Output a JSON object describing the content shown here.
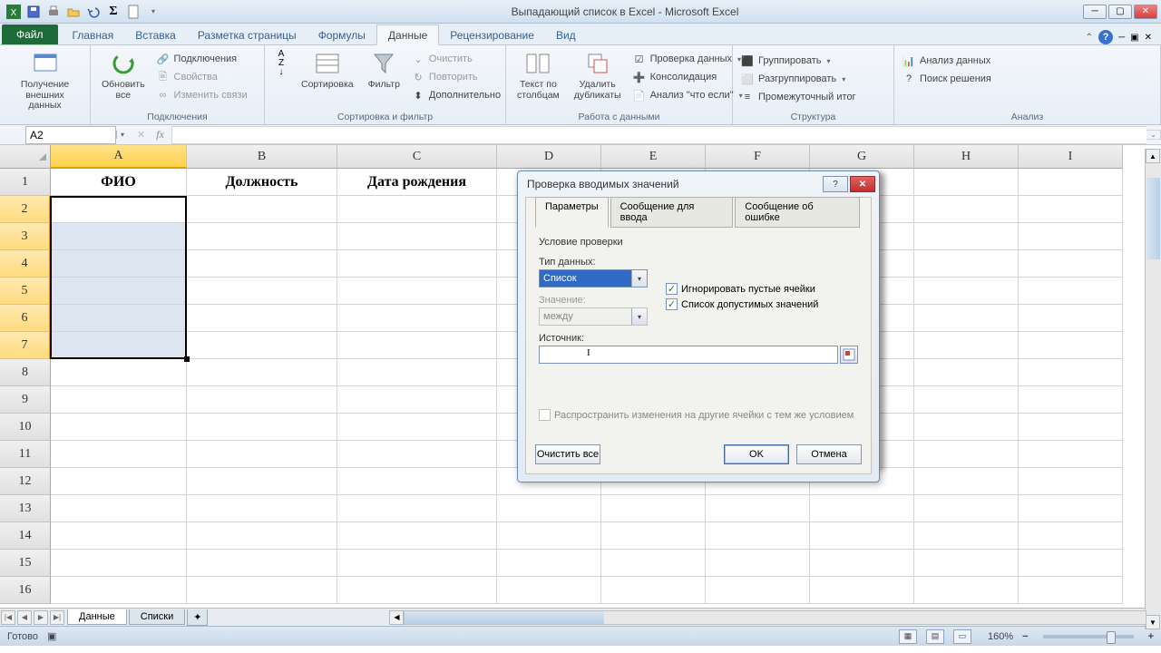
{
  "app": {
    "title": "Выпадающий список в Excel - Microsoft Excel"
  },
  "window_controls": {
    "minimize": "_",
    "maximize": "▢",
    "close": "✕"
  },
  "tabs": {
    "file": "Файл",
    "items": [
      "Главная",
      "Вставка",
      "Разметка страницы",
      "Формулы",
      "Данные",
      "Рецензирование",
      "Вид"
    ],
    "active_index": 4
  },
  "ribbon": {
    "connections": {
      "get_external": "Получение\nвнешних данных",
      "refresh_all": "Обновить\nвсе",
      "connections_btn": "Подключения",
      "properties": "Свойства",
      "edit_links": "Изменить связи",
      "group": "Подключения"
    },
    "sortfilter": {
      "sort": "Сортировка",
      "filter": "Фильтр",
      "clear": "Очистить",
      "reapply": "Повторить",
      "advanced": "Дополнительно",
      "group": "Сортировка и фильтр"
    },
    "datatools": {
      "text_to_cols": "Текст по\nстолбцам",
      "remove_dup": "Удалить\nдубликаты",
      "data_validation": "Проверка данных",
      "consolidate": "Консолидация",
      "whatif": "Анализ \"что если\"",
      "group": "Работа с данными"
    },
    "outline": {
      "group_btn": "Группировать",
      "ungroup": "Разгруппировать",
      "subtotal": "Промежуточный итог",
      "group": "Структура"
    },
    "analysis": {
      "data_analysis": "Анализ данных",
      "solver": "Поиск решения",
      "group": "Анализ"
    }
  },
  "name_box": "A2",
  "columns": [
    "A",
    "B",
    "C",
    "D",
    "E",
    "F",
    "G",
    "H",
    "I"
  ],
  "rows": [
    "1",
    "2",
    "3",
    "4",
    "5",
    "6",
    "7",
    "8",
    "9",
    "10",
    "11",
    "12",
    "13",
    "14",
    "15",
    "16"
  ],
  "headers": [
    "ФИО",
    "Должность",
    "Дата рождения"
  ],
  "dialog": {
    "title": "Проверка вводимых значений",
    "tabs": [
      "Параметры",
      "Сообщение для ввода",
      "Сообщение об ошибке"
    ],
    "section": "Условие проверки",
    "type_label": "Тип данных:",
    "type_value": "Список",
    "ignore_blank": "Игнорировать пустые ячейки",
    "in_cell_dropdown": "Список допустимых значений",
    "data_label": "Значение:",
    "data_value": "между",
    "source_label": "Источник:",
    "apply_changes": "Распространить изменения на другие ячейки с тем же условием",
    "clear_all": "Очистить все",
    "ok": "OK",
    "cancel": "Отмена"
  },
  "sheet_tabs": [
    "Данные",
    "Списки"
  ],
  "status": {
    "ready": "Готово",
    "zoom": "160%"
  }
}
